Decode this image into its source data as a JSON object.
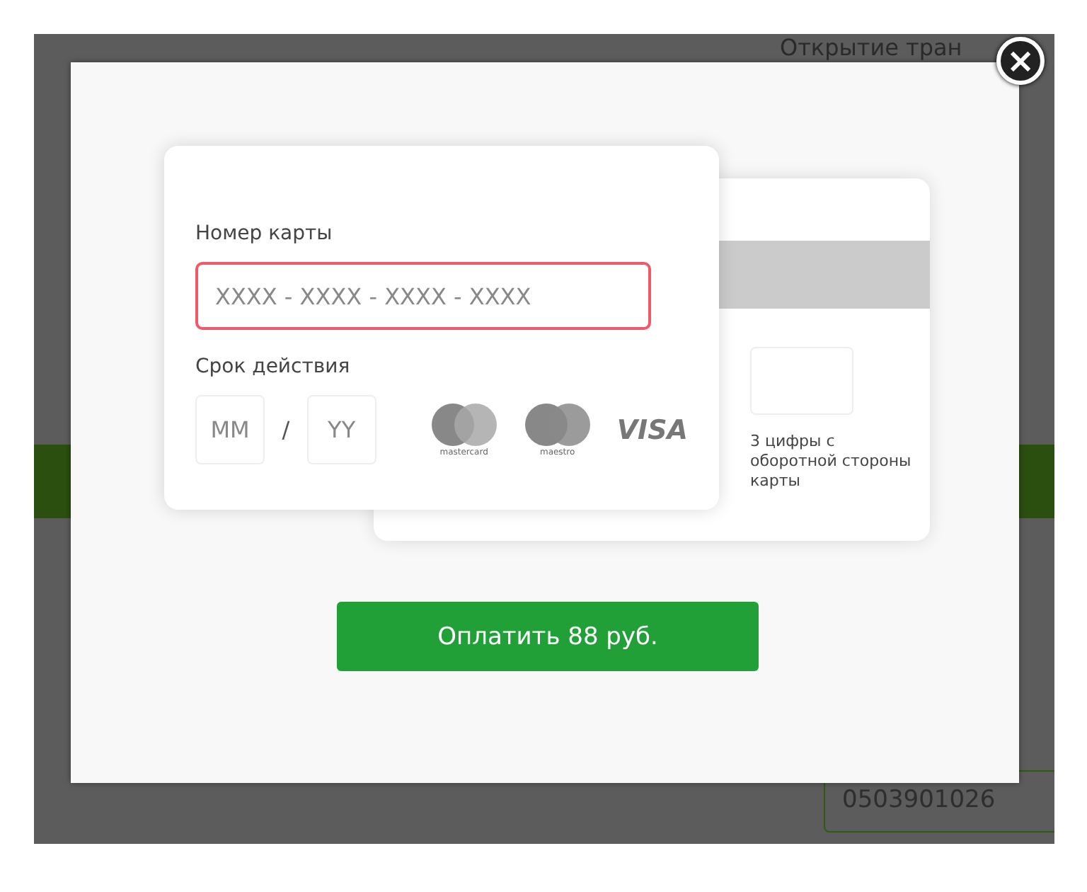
{
  "background_page": {
    "heading": "Открытие тран",
    "phone": "0503901026"
  },
  "dialog": {
    "close_label": "×",
    "card_front": {
      "number_label": "Номер карты",
      "number_placeholder": "XXXX - XXXX - XXXX - XXXX",
      "number_invalid": true,
      "expiry_label": "Срок действия",
      "month_placeholder": "MM",
      "separator": "/",
      "year_placeholder": "YY",
      "brands": [
        {
          "kind": "mastercard",
          "caption": "mastercard"
        },
        {
          "kind": "maestro",
          "caption": "maestro"
        },
        {
          "kind": "visa",
          "caption": "VISA"
        }
      ]
    },
    "card_back": {
      "cvv_hint": "3 цифры с оборотной стороны карты"
    },
    "pay_button": "Оплатить 88 руб."
  }
}
